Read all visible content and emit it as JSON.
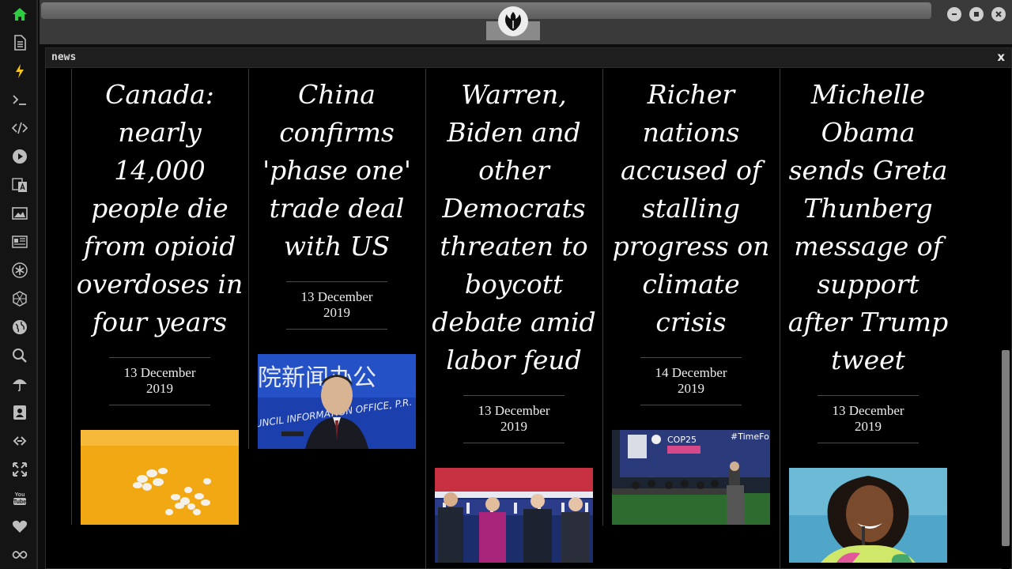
{
  "window": {
    "title": "news",
    "close_label": "x"
  },
  "sidebar": {
    "items": [
      {
        "name": "home-icon"
      },
      {
        "name": "document-icon"
      },
      {
        "name": "lightning-icon"
      },
      {
        "name": "terminal-icon"
      },
      {
        "name": "code-icon"
      },
      {
        "name": "play-icon"
      },
      {
        "name": "translate-icon"
      },
      {
        "name": "image-icon"
      },
      {
        "name": "newspaper-icon"
      },
      {
        "name": "asterisk-icon"
      },
      {
        "name": "hexagon-icon"
      },
      {
        "name": "globe-icon"
      },
      {
        "name": "search-icon"
      },
      {
        "name": "umbrella-icon"
      },
      {
        "name": "contact-card-icon"
      },
      {
        "name": "link-icon"
      },
      {
        "name": "expand-icon"
      },
      {
        "name": "youtube-icon"
      },
      {
        "name": "heart-icon"
      },
      {
        "name": "infinity-icon"
      }
    ],
    "active": "home-icon",
    "accent_color": "#2ecc40"
  },
  "youtube_label": "You Tube",
  "articles": [
    {
      "headline": "Canada: nearly 14,000 people die from opioid overdoses in four years",
      "date": "13 December 2019",
      "image": "pills-on-orange-image"
    },
    {
      "headline": "China confirms 'phase one' trade deal with US",
      "date": "13 December 2019",
      "image": "press-conference-image",
      "image_text": "院新闻办公",
      "image_text2": "UNCIL INFORMATION OFFICE, P.R."
    },
    {
      "headline": "Warren, Biden and other Democrats threaten to boycott debate amid labor feud",
      "date": "13 December 2019",
      "image": "candidates-on-stage-image"
    },
    {
      "headline": "Richer nations accused of stalling progress on climate crisis",
      "date": "14 December 2019",
      "image": "cop25-panel-image",
      "image_text": "COP25",
      "image_text2": "#TimeFo"
    },
    {
      "headline": "Michelle Obama sends Greta Thunberg message of support after Trump tweet",
      "date": "13 December 2019",
      "image": "michelle-obama-portrait-image"
    }
  ]
}
